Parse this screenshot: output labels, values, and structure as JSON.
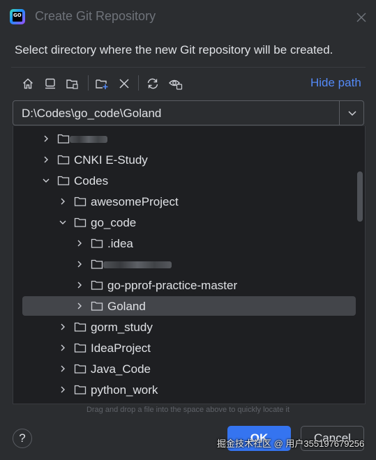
{
  "window": {
    "title": "Create Git Repository",
    "app_icon": "goland-icon",
    "app_icon_text": "GO"
  },
  "subtitle": "Select directory where the new Git repository will be created.",
  "toolbar": {
    "icons": [
      "home-icon",
      "desktop-icon",
      "project-folder-icon",
      "new-folder-icon",
      "delete-icon",
      "refresh-icon",
      "show-hidden-icon"
    ],
    "hide_path_label": "Hide path"
  },
  "path_field": {
    "value": "D:\\Codes\\go_code\\Goland",
    "dropdown_icon": "chevron-down-icon"
  },
  "tree": {
    "items": [
      {
        "label": "",
        "depth": 0,
        "expanded": false,
        "redacted": true
      },
      {
        "label": "CNKI E-Study",
        "depth": 0,
        "expanded": false
      },
      {
        "label": "Codes",
        "depth": 0,
        "expanded": true
      },
      {
        "label": "awesomeProject",
        "depth": 1,
        "expanded": false
      },
      {
        "label": "go_code",
        "depth": 1,
        "expanded": true
      },
      {
        "label": ".idea",
        "depth": 2,
        "expanded": false
      },
      {
        "label": "",
        "depth": 2,
        "expanded": false,
        "redacted": true
      },
      {
        "label": "go-pprof-practice-master",
        "depth": 2,
        "expanded": false
      },
      {
        "label": "Goland",
        "depth": 2,
        "expanded": false,
        "selected": true
      },
      {
        "label": "gorm_study",
        "depth": 1,
        "expanded": false
      },
      {
        "label": "IdeaProject",
        "depth": 1,
        "expanded": false
      },
      {
        "label": "Java_Code",
        "depth": 1,
        "expanded": false
      },
      {
        "label": "python_work",
        "depth": 1,
        "expanded": false
      }
    ]
  },
  "hint": "Drag and drop a file into the space above to quickly locate it",
  "footer": {
    "help_label": "?",
    "ok_label": "OK",
    "cancel_label": "Cancel"
  },
  "watermark": "掘金技术社区 @ 用户3551976​79256",
  "colors": {
    "background": "#2b2d30",
    "tree_background": "#1e1f22",
    "accent": "#3574f0",
    "link": "#548af7",
    "selection": "#43454a"
  }
}
